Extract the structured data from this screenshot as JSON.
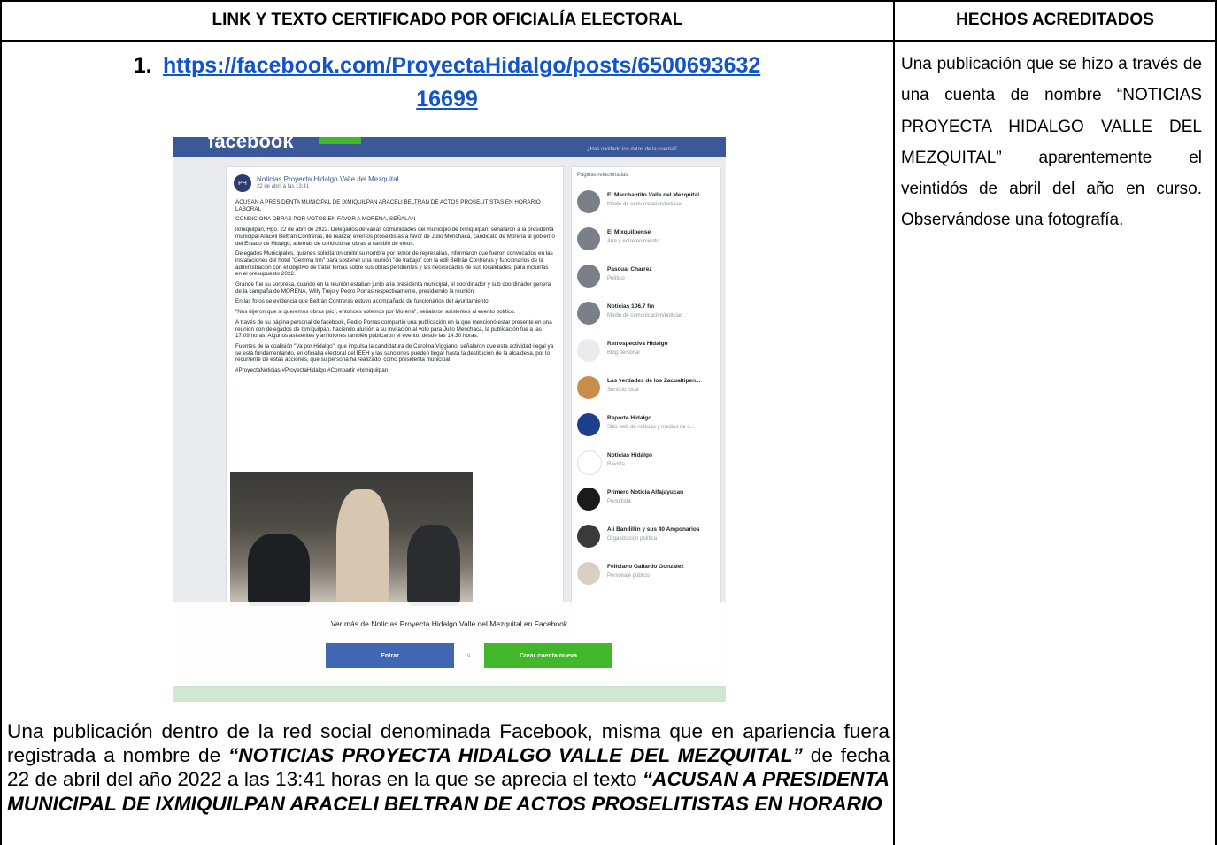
{
  "table": {
    "col1_header": "LINK Y TEXTO CERTIFICADO POR OFICIALÍA ELECTORAL",
    "col2_header": "HECHOS ACREDITADOS"
  },
  "entry": {
    "number": "1.",
    "link_line1": "https://facebook.com/ProyectaHidalgo/posts/6500693632",
    "link_line2": "16699",
    "facts_text": "Una publicación que se hizo a través de una cuenta de nombre “NOTICIAS PROYECTA HIDALGO VALLE DEL MEZQUITAL” aparentemente el veintidós de abril del año en curso. Observándose una fotografía.",
    "desc_part1": "Una publicación dentro de la red social denominada Facebook, misma que en apariencia fuera registrada a nombre de ",
    "desc_bold1": "“NOTICIAS PROYECTA HIDALGO VALLE DEL MEZQUITAL”",
    "desc_part2": " de fecha 22 de abril del año 2022 a las 13:41 horas en la que se aprecia el texto ",
    "desc_bold2": "“ACUSAN A PRESIDENTA MUNICIPAL DE IXMIQUILPAN ARACELI BELTRAN DE ACTOS PROSELITISTAS EN HORARIO"
  },
  "screenshot": {
    "logo": "facebook",
    "topbar_link": "¿Has olvidado los datos de la cuenta?",
    "post": {
      "avatar_text": "PH",
      "page_name": "Noticias Proyecta Hidalgo Valle del Mezquital",
      "date": "22 de abril a las 13:41",
      "paragraphs": [
        "ACUSAN A PRESIDENTA MUNICIPAL DE IXMIQUILPAN ARACELI BELTRAN DE ACTOS PROSELITISTAS EN HORARIO LABORAL",
        "CONDICIONA OBRAS POR VOTOS EN FAVOR A MORENA, SEÑALAN",
        "Ixmiquilpan, Hgo. 22 de abril de 2022. Delegados de varias comunidades del municipio de Ixmiquilpan, señalaron a la presidenta municipal Araceli Beltrán Contreras, de realizar eventos proselitistas a favor de Julio Menchaca, candidato de Morena al gobierno del Estado de Hidalgo, además de condicionar obras a cambio de votos.",
        "Delegados Municipales, quienes solicitaron omitir su nombre por temor de represalias, informaron que fueron convocados en las instalaciones del hotel \"Gemma Inn\" para sostener una reunión \"de trabajo\" con la edil Beltrán Contreras y funcionarios de la administración con el objetivo de tratar temas sobre sus obras pendientes y las necesidades de sus localidades, para incluirlas en el presupuesto 2022.",
        "Grande fue su sorpresa, cuando en la reunión estaban junto a la presidenta municipal, el coordinador y sub coordinador general de la campaña de MORENA, Willy Trejo y Pedro Porras respectivamente, presidiendo la reunión.",
        "En las fotos se evidencia que Beltrán Contreras estuvo acompañada de funcionarios del ayuntamiento.",
        "\"Nos dijeron que si queremos obras (sic), entonces votemos por Morena\", señalaron asistentes al evento político.",
        "A través de su página personal de facebook, Pedro Porras compartió una publicación en la que mencionó estar presente en una reunión con delegados de Ixmiquilpan, haciendo alusión a su invitación al voto para Julio Menchaca, la publicación fue a las 17:09 horas. Algunos asistentes y anfitriones también publicaron el evento, desde las 14:30 horas.",
        "Fuentes de la coalisión \"Va por Hidalgo\", que impulsa la candidatura de Carolina Viggiano, señalaron que esta actividad ilegal ya se está fundamentando, en oficialía electoral del IEEH y las sanciones pueden llegar hasta la destitución de la alcaldesa, por lo recurrente de estas acciones, que su persona ha realizado, como presidenta municipal.",
        "#ProyectaNoticias #ProyectaHidalgo #Compartir #Ixmiquilpan"
      ]
    },
    "sidebar": {
      "title": "Páginas relacionadas",
      "items": [
        {
          "name": "El Marchantito Valle del Mezquital",
          "sub": "Medio de comunicación/noticias"
        },
        {
          "name": "El Mixquilpense",
          "sub": "Arte y entretenimiento"
        },
        {
          "name": "Pascual Charrez",
          "sub": "Político"
        },
        {
          "name": "Noticias 106.7 fm",
          "sub": "Medio de comunicación/noticias"
        },
        {
          "name": "Retrospectiva Hidalgo",
          "sub": "Blog personal"
        },
        {
          "name": "Las verdades de los Zacualtipen...",
          "sub": "Servicio local"
        },
        {
          "name": "Reporte Hidalgo",
          "sub": "Sitio web de noticias y medios de c..."
        },
        {
          "name": "Noticias Hidalgo",
          "sub": "Revista"
        },
        {
          "name": "Primero Noticia Alfajayucan",
          "sub": "Periodista"
        },
        {
          "name": "Ali Bandillin y sus 40 Amponarios",
          "sub": "Organización política"
        },
        {
          "name": "Feliciano Gallardo Gonzalez",
          "sub": "Personaje público"
        }
      ]
    },
    "overlay": {
      "text": "Ver más de Noticias Proyecta Hidalgo Valle del Mezquital en Facebook",
      "login_label": "Entrar",
      "or_label": "o",
      "signup_label": "Crear cuenta nueva"
    },
    "colors": {
      "fb_blue": "#3b5998",
      "button_blue": "#4267b2",
      "button_green": "#42b72a",
      "link_blue": "#1155cc"
    }
  }
}
